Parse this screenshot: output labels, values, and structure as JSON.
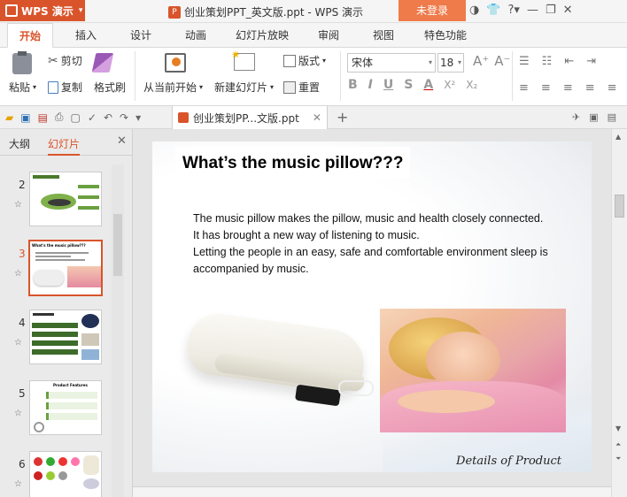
{
  "app": {
    "brand": "WPS 演示",
    "doc_title": "创业策划PPT_英文版.ppt - WPS 演示",
    "login": "未登录"
  },
  "tabs": [
    "开始",
    "插入",
    "设计",
    "动画",
    "幻灯片放映",
    "审阅",
    "视图",
    "特色功能"
  ],
  "ribbon": {
    "paste": "粘贴",
    "cut": "剪切",
    "copy": "复制",
    "format_painter": "格式刷",
    "from_current": "从当前开始",
    "new_slide": "新建幻灯片",
    "layout": "版式",
    "reset": "重置",
    "font_name": "宋体",
    "font_size": "18",
    "bold": "B",
    "italic": "I",
    "underline": "U",
    "strike": "S",
    "font_color": "A",
    "superscript": "X²",
    "subscript": "X₂"
  },
  "doc_tab": {
    "label": "创业策划PP...文版.ppt"
  },
  "sidebar": {
    "tab_outline": "大纲",
    "tab_slides": "幻灯片",
    "slides": [
      {
        "num": "2"
      },
      {
        "num": "3"
      },
      {
        "num": "4"
      },
      {
        "num": "5"
      },
      {
        "num": "6"
      }
    ],
    "thumb3_title": "What's the music pillow???",
    "thumb5_title": "Product Features"
  },
  "slide": {
    "title": "What’s the music pillow???",
    "paragraph_1": "The music pillow makes the pillow, music and health closely connected.",
    "paragraph_2": "It has brought a new way of listening to music.",
    "paragraph_3a": "Letting the people in an easy, safe and comfortable environment sleep is",
    "paragraph_3b": "accompanied by music.",
    "footer": "Details of Product"
  },
  "colors": {
    "accent": "#d9542b",
    "login": "#ef7a4a",
    "active_thumb_border": "#d9542b"
  }
}
